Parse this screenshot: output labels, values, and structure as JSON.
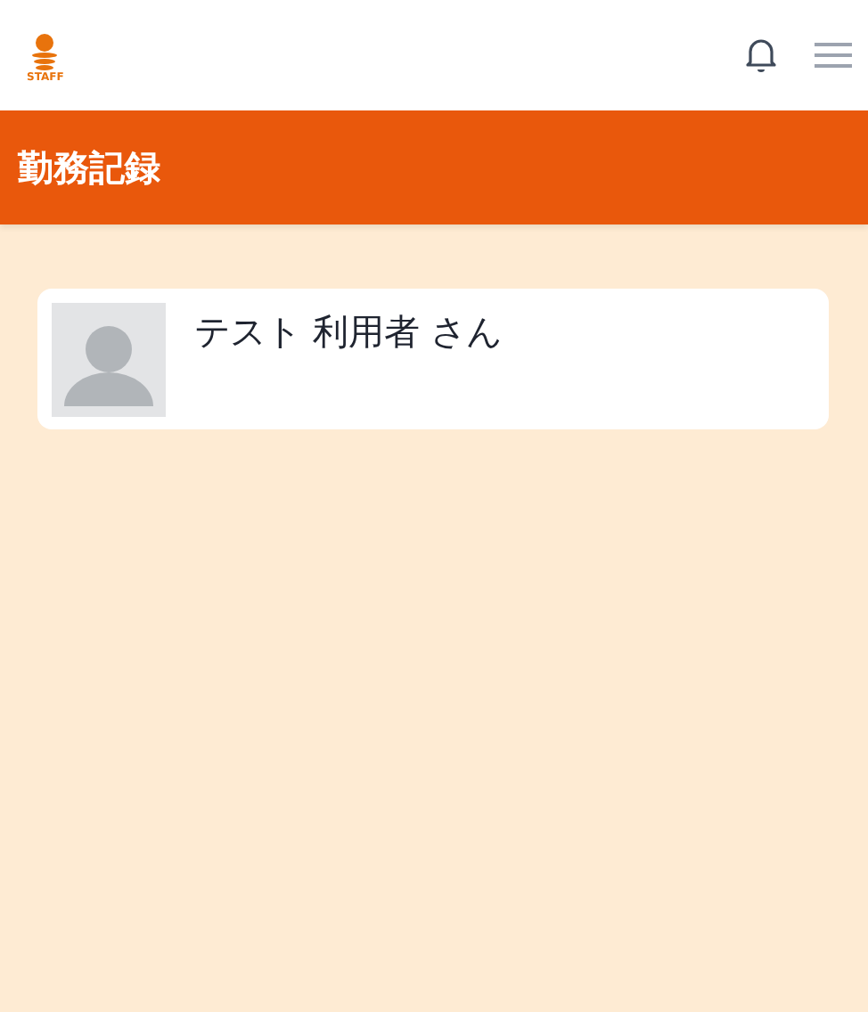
{
  "header": {
    "logo_text": "STAFF"
  },
  "title_bar": {
    "title": "勤務記録"
  },
  "users": [
    {
      "name": "テスト 利用者 さん"
    }
  ]
}
